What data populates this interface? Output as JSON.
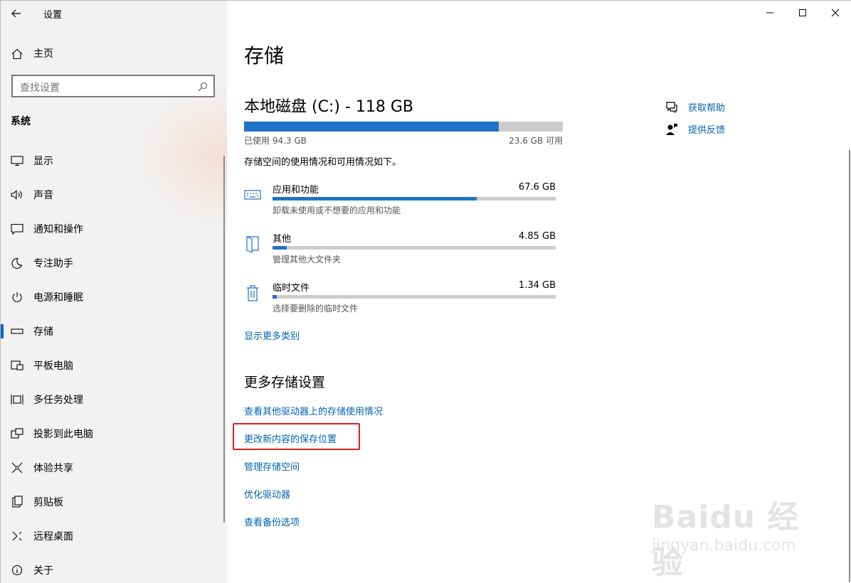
{
  "app": {
    "title": "设置"
  },
  "sidebar": {
    "home_label": "主页",
    "search_placeholder": "查找设置",
    "section_title": "系统",
    "items": [
      {
        "label": "显示",
        "icon": "display-icon"
      },
      {
        "label": "声音",
        "icon": "sound-icon"
      },
      {
        "label": "通知和操作",
        "icon": "notification-icon"
      },
      {
        "label": "专注助手",
        "icon": "moon-icon"
      },
      {
        "label": "电源和睡眠",
        "icon": "power-icon"
      },
      {
        "label": "存储",
        "icon": "storage-icon",
        "active": true
      },
      {
        "label": "平板电脑",
        "icon": "tablet-icon"
      },
      {
        "label": "多任务处理",
        "icon": "multitask-icon"
      },
      {
        "label": "投影到此电脑",
        "icon": "project-icon"
      },
      {
        "label": "体验共享",
        "icon": "share-icon"
      },
      {
        "label": "剪贴板",
        "icon": "clipboard-icon"
      },
      {
        "label": "远程桌面",
        "icon": "remote-desktop-icon"
      },
      {
        "label": "关于",
        "icon": "info-icon"
      }
    ]
  },
  "main": {
    "page_title": "存储",
    "disk": {
      "title": "本地磁盘 (C:) - 118 GB",
      "used_label": "已使用 94.3 GB",
      "free_label": "23.6 GB 可用",
      "used_fraction": 0.8
    },
    "description": "存储空间的使用情况和可用情况如下。",
    "categories": [
      {
        "name": "应用和功能",
        "size": "67.6 GB",
        "sub": "卸载未使用或不想要的应用和功能",
        "fraction": 0.72,
        "icon": "keyboard-icon"
      },
      {
        "name": "其他",
        "size": "4.85 GB",
        "sub": "管理其他大文件夹",
        "fraction": 0.05,
        "icon": "folder-icon"
      },
      {
        "name": "临时文件",
        "size": "1.34 GB",
        "sub": "选择要删除的临时文件",
        "fraction": 0.015,
        "icon": "trash-icon"
      }
    ],
    "show_more": "显示更多类别",
    "more_title": "更多存储设置",
    "more_links": [
      "查看其他驱动器上的存储使用情况",
      "更改新内容的保存位置",
      "管理存储空间",
      "优化驱动器",
      "查看备份选项"
    ],
    "help": {
      "get_help": "获取帮助",
      "feedback": "提供反馈"
    }
  },
  "watermark": {
    "big": "Baidu 经验",
    "small": "jingyan.baidu.com"
  },
  "colors": {
    "accent": "#1f73c4",
    "link": "#0063b1",
    "highlight": "#e02020"
  }
}
